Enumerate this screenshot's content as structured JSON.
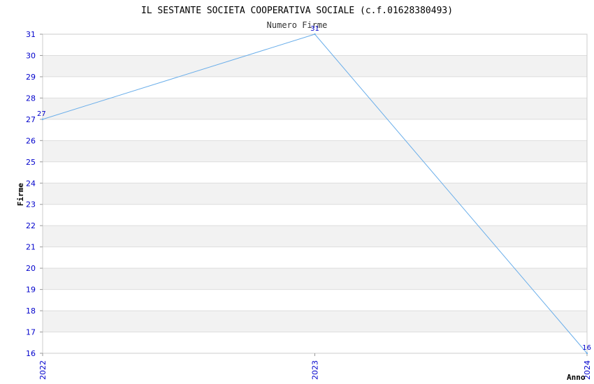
{
  "chart_data": {
    "type": "line",
    "title": "IL SESTANTE SOCIETA COOPERATIVA SOCIALE (c.f.01628380493)",
    "subtitle": "Numero Firme",
    "xlabel": "Anno",
    "ylabel": "Firme",
    "x": [
      "2022",
      "2023",
      "2024"
    ],
    "series": [
      {
        "values": [
          27,
          31,
          16
        ]
      }
    ],
    "ylim": [
      16,
      31
    ],
    "yticks": [
      16,
      17,
      18,
      19,
      20,
      21,
      22,
      23,
      24,
      25,
      26,
      27,
      28,
      29,
      30,
      31
    ],
    "grid": true,
    "line_color": "#6aaeea",
    "band_color": "#f2f2f2",
    "tick_color": "#0000cc"
  }
}
